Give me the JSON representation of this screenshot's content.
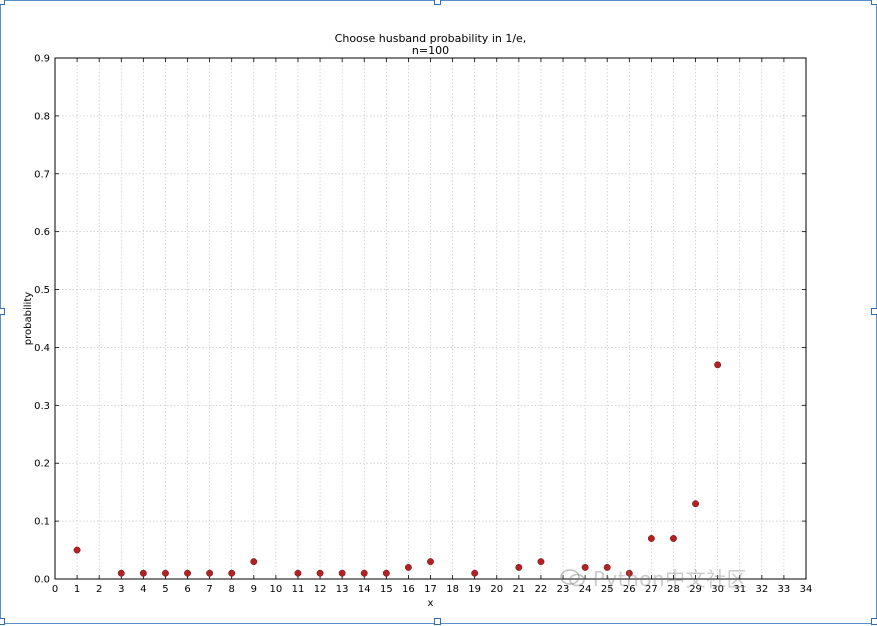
{
  "chart_data": {
    "type": "scatter",
    "title_lines": [
      "Choose husband probability in 1/e,",
      "n=100"
    ],
    "xlabel": "x",
    "ylabel": "probability",
    "xlim": [
      0,
      34
    ],
    "ylim": [
      0,
      0.9
    ],
    "x_ticks": [
      0,
      1,
      2,
      3,
      4,
      5,
      6,
      7,
      8,
      9,
      10,
      11,
      12,
      13,
      14,
      15,
      16,
      17,
      18,
      19,
      20,
      21,
      22,
      23,
      24,
      25,
      26,
      27,
      28,
      29,
      30,
      31,
      32,
      33,
      34
    ],
    "y_ticks": [
      0.0,
      0.1,
      0.2,
      0.3,
      0.4,
      0.5,
      0.6,
      0.7,
      0.8,
      0.9
    ],
    "grid": true,
    "series": [
      {
        "points": [
          {
            "x": 1,
            "y": 0.05
          },
          {
            "x": 3,
            "y": 0.01
          },
          {
            "x": 4,
            "y": 0.01
          },
          {
            "x": 5,
            "y": 0.01
          },
          {
            "x": 6,
            "y": 0.01
          },
          {
            "x": 7,
            "y": 0.01
          },
          {
            "x": 8,
            "y": 0.01
          },
          {
            "x": 9,
            "y": 0.03
          },
          {
            "x": 11,
            "y": 0.01
          },
          {
            "x": 12,
            "y": 0.01
          },
          {
            "x": 13,
            "y": 0.01
          },
          {
            "x": 14,
            "y": 0.01
          },
          {
            "x": 15,
            "y": 0.01
          },
          {
            "x": 16,
            "y": 0.02
          },
          {
            "x": 17,
            "y": 0.03
          },
          {
            "x": 19,
            "y": 0.01
          },
          {
            "x": 21,
            "y": 0.02
          },
          {
            "x": 22,
            "y": 0.03
          },
          {
            "x": 24,
            "y": 0.02
          },
          {
            "x": 25,
            "y": 0.02
          },
          {
            "x": 26,
            "y": 0.01
          },
          {
            "x": 27,
            "y": 0.07
          },
          {
            "x": 28,
            "y": 0.07
          },
          {
            "x": 29,
            "y": 0.13
          },
          {
            "x": 30,
            "y": 0.37
          }
        ]
      }
    ],
    "marker_color": "#b22222"
  },
  "watermark": {
    "text": "Python中文社区",
    "icon": "chat-bubbles-icon"
  }
}
